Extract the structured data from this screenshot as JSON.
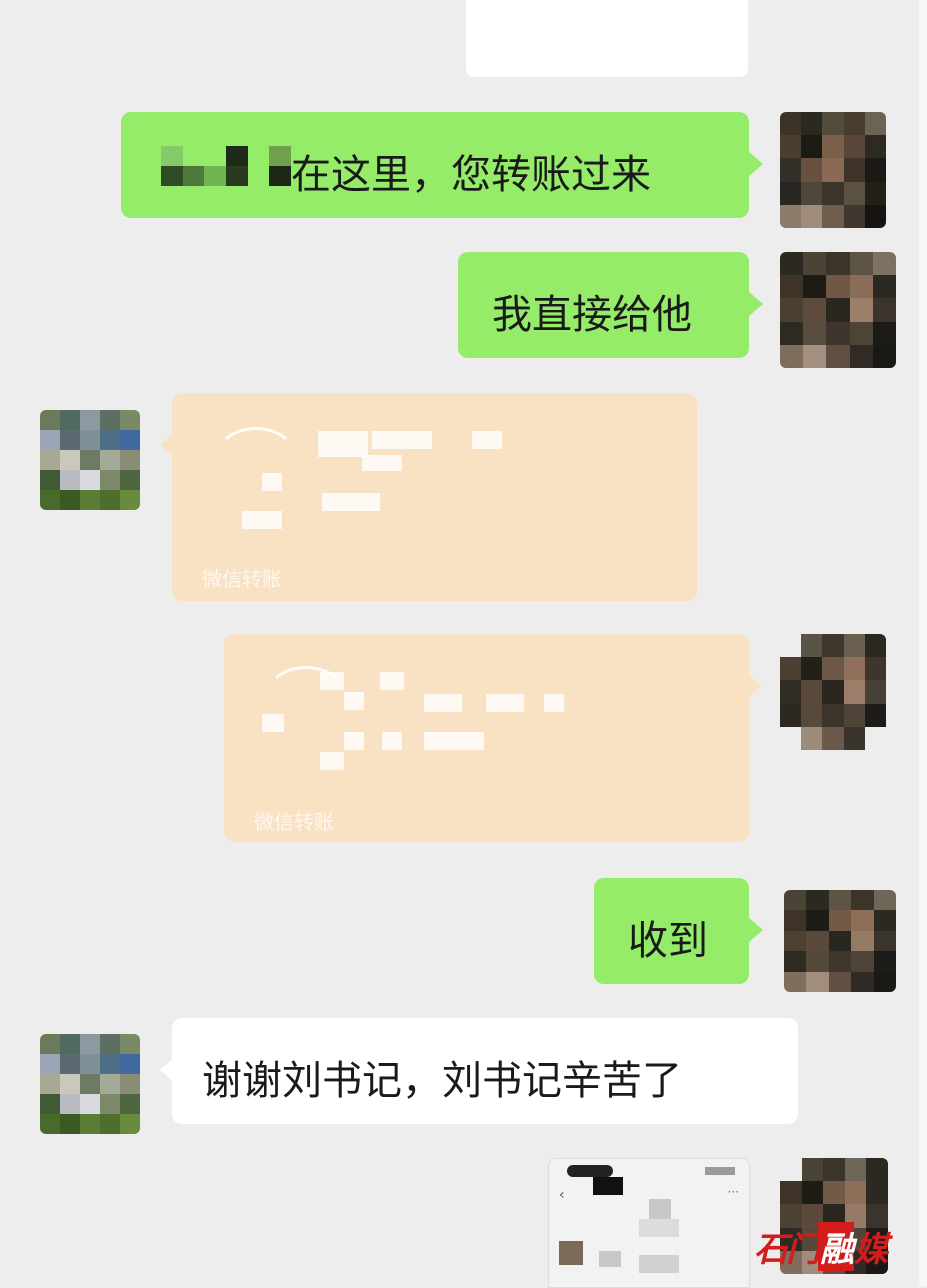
{
  "messages": [
    {
      "id": "m1",
      "side": "right",
      "type": "text",
      "text": "在这里，您转账过来",
      "obscured_prefix": true
    },
    {
      "id": "m2",
      "side": "right",
      "type": "text",
      "text": "我直接给他"
    },
    {
      "id": "m3",
      "side": "left",
      "type": "transfer",
      "label": "微信转账"
    },
    {
      "id": "m4",
      "side": "right",
      "type": "transfer",
      "label": "微信转账"
    },
    {
      "id": "m5",
      "side": "right",
      "type": "text",
      "text": "收到"
    },
    {
      "id": "m6",
      "side": "left",
      "type": "text",
      "text": "谢谢刘书记，刘书记辛苦了"
    },
    {
      "id": "m7",
      "side": "right",
      "type": "image-thumbnail"
    }
  ],
  "watermark": {
    "part1": "石门",
    "part2": "融",
    "part3": "媒"
  },
  "colors": {
    "background": "#ededed",
    "bubble_self": "#95ec69",
    "bubble_other": "#ffffff",
    "transfer_bubble": "#f9e2c3",
    "watermark": "#d31c1c"
  },
  "avatars": {
    "self": "pixelated-avatar",
    "other": "pixelated-avatar"
  }
}
